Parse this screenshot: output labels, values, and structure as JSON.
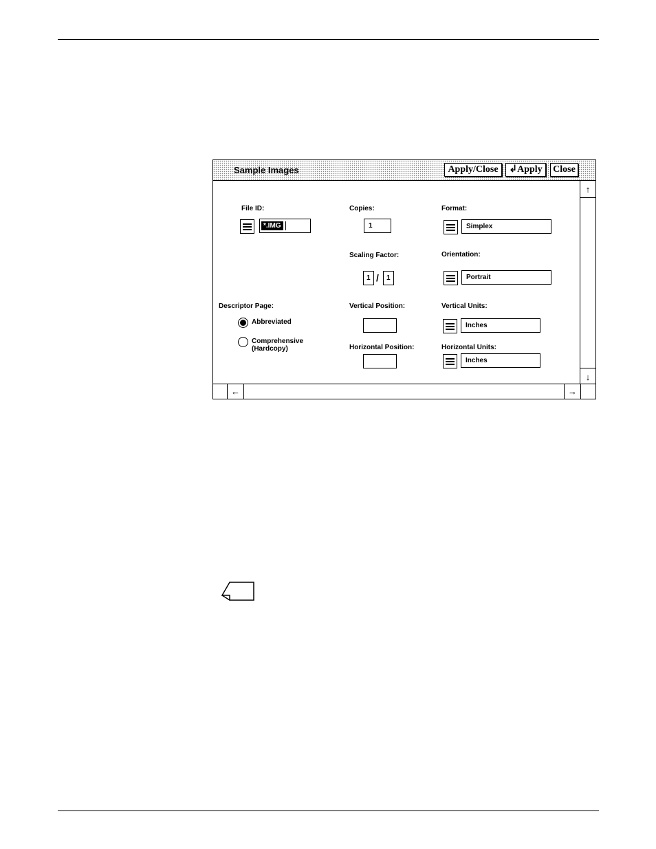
{
  "window": {
    "title": "Sample Images",
    "buttons": {
      "apply_close": "Apply/Close",
      "apply": "Apply",
      "close": "Close"
    }
  },
  "file_id": {
    "label": "File ID:",
    "value": "*.IMG"
  },
  "copies": {
    "label": "Copies:",
    "value": "1"
  },
  "format": {
    "label": "Format:",
    "value": "Simplex"
  },
  "scaling_factor": {
    "label": "Scaling Factor:",
    "numerator": "1",
    "separator": "/",
    "denominator": "1"
  },
  "orientation": {
    "label": "Orientation:",
    "value": "Portrait"
  },
  "descriptor_page": {
    "label": "Descriptor Page:",
    "options": [
      {
        "label": "Abbreviated",
        "selected": true
      },
      {
        "label": "Comprehensive",
        "sublabel": "(Hardcopy)",
        "selected": false
      }
    ]
  },
  "vertical_position": {
    "label": "Vertical Position:",
    "value": ""
  },
  "horizontal_position": {
    "label": "Horizontal Position:",
    "value": ""
  },
  "vertical_units": {
    "label": "Vertical Units:",
    "value": "Inches"
  },
  "horizontal_units": {
    "label": "Horizontal Units:",
    "value": "Inches"
  },
  "icons": {
    "menu": "menu-icon",
    "scroll_up": "arrow-up-icon",
    "scroll_down": "arrow-down-icon",
    "scroll_left": "arrow-left-icon",
    "scroll_right": "arrow-right-icon",
    "return": "return-arrow-icon",
    "note": "note-icon"
  }
}
